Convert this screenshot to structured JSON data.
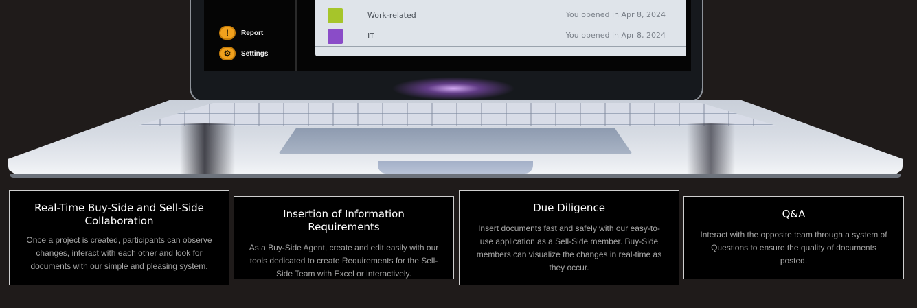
{
  "screen": {
    "sidebar": {
      "items": [
        {
          "label": "Report",
          "icon": "alert-icon",
          "glyph": "!"
        },
        {
          "label": "Settings",
          "icon": "gear-icon",
          "glyph": "⚙"
        }
      ]
    },
    "files": [
      {
        "name": "Work-related",
        "opened": "You opened in Apr 8, 2024",
        "color": "#a6c52a"
      },
      {
        "name": "IT",
        "opened": "You opened in Apr 8, 2024",
        "color": "#8a4cc8"
      }
    ]
  },
  "features": [
    {
      "title": "Real-Time Buy-Side and Sell-Side Collaboration",
      "description": "Once a project is created, participants can observe changes, interact with each other and look for documents with our simple and pleasing system."
    },
    {
      "title": "Insertion of Information Requirements",
      "description": "As a Buy-Side Agent, create and edit easily with our tools dedicated to create Requirements for the Sell-Side Team with Excel or interactively."
    },
    {
      "title": "Due Diligence",
      "description": "Insert documents fast and safely with our easy-to-use application as a Sell-Side member. Buy-Side members can visualize the changes in real-time as they occur."
    },
    {
      "title": "Q&A",
      "description": "Interact with the opposite team through a system of Questions to ensure the quality of documents posted."
    }
  ],
  "colors": {
    "page_background": "#1f1b1a",
    "card_background": "#000000",
    "accent_orange": "#f1a11d"
  }
}
